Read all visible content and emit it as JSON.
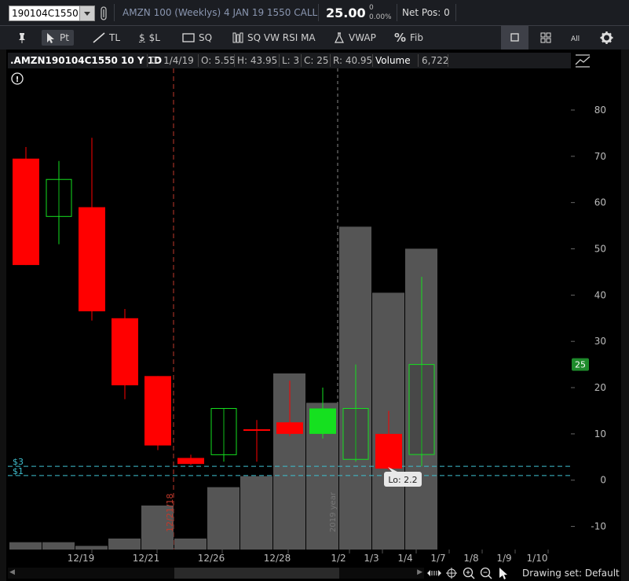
{
  "topbar": {
    "symbol": "190104C1550",
    "description": "AMZN 100 (Weeklys) 4 JAN 19 1550 CALL",
    "last_price": "25.00",
    "change": "0",
    "change_pct": "0.00%",
    "net_pos": "Net Pos: 0"
  },
  "toolbar": {
    "pin_label": "",
    "pointer_label": "Pt",
    "trendline_label": "TL",
    "price_level_label": "$L",
    "square_label": "SQ",
    "studies_label": "SQ VW RSI MA",
    "vwap_label": "VWAP",
    "fib_label": "Fib"
  },
  "infobar": {
    "symbol": ".AMZN190104C1550 10 Y 1D",
    "date": "D: 1/4/19",
    "open": "O: 5.55",
    "high": "H: 43.95",
    "low": "L: 3",
    "close": "C: 25",
    "range": "R: 40.95",
    "volume_label": "Volume",
    "volume_value": "6,722"
  },
  "chart_data": {
    "type": "candlestick",
    "y_ticks": [
      "80",
      "70",
      "60",
      "50",
      "40",
      "30",
      "20",
      "10",
      "0",
      "-10"
    ],
    "ylim": [
      -15,
      89
    ],
    "x_labels": [
      "12/19",
      "12/21",
      "12/26",
      "12/28",
      "1/2",
      "1/3",
      "1/4",
      "1/7",
      "1/8",
      "1/9",
      "1/10"
    ],
    "candles": [
      {
        "date": "12/18",
        "open": 69.5,
        "high": 72,
        "low": 46.5,
        "close": 46.5,
        "color": "red"
      },
      {
        "date": "12/19",
        "open": 57,
        "high": 69,
        "low": 51,
        "close": 65,
        "color": "green"
      },
      {
        "date": "12/19b",
        "open": 59,
        "high": 74,
        "low": 34.5,
        "close": 36.5,
        "color": "red"
      },
      {
        "date": "12/20",
        "open": 35,
        "high": 37,
        "low": 17.5,
        "close": 20.5,
        "color": "red"
      },
      {
        "date": "12/21",
        "open": 22.5,
        "high": 22.5,
        "low": 6.5,
        "close": 7.5,
        "color": "red"
      },
      {
        "date": "12/24",
        "open": 4.8,
        "high": 5.5,
        "low": 3.3,
        "close": 3.5,
        "color": "red"
      },
      {
        "date": "12/26",
        "open": 5.5,
        "high": 15.5,
        "low": 4,
        "close": 15.5,
        "color": "green"
      },
      {
        "date": "12/27",
        "open": 11,
        "high": 13,
        "low": 4,
        "close": 11,
        "color": "red"
      },
      {
        "date": "12/28",
        "open": 12.5,
        "high": 21.5,
        "low": 9.5,
        "close": 10,
        "color": "red"
      },
      {
        "date": "12/31",
        "open": 10,
        "high": 20,
        "low": 9,
        "close": 15.5,
        "color": "green_fill"
      },
      {
        "date": "1/2",
        "open": 4.5,
        "high": 25,
        "low": 4,
        "close": 15.5,
        "color": "green"
      },
      {
        "date": "1/3",
        "open": 10,
        "high": 15,
        "low": 2.2,
        "close": 2.5,
        "color": "red"
      },
      {
        "date": "1/4",
        "open": 5.55,
        "high": 43.95,
        "low": 3,
        "close": 25,
        "color": "green"
      }
    ],
    "volume": [
      1,
      1,
      0.5,
      1.5,
      6,
      1.5,
      8.5,
      10,
      24,
      20,
      44,
      35,
      41
    ],
    "levels": [
      {
        "label": "$3",
        "value": 3
      },
      {
        "label": "$1",
        "value": 1
      }
    ],
    "current_price_tag": "25",
    "tooltip": "Lo: 2.2",
    "year_marker": "12/21/18",
    "year_marker_2": "2019 year"
  },
  "bottombar": {
    "drawing_set": "Drawing set: Default"
  },
  "colors": {
    "up": "#15e01f",
    "down": "#ff0000",
    "volume": "#555555",
    "level": "#3fbfcf",
    "tag": "#1e8a2b"
  }
}
